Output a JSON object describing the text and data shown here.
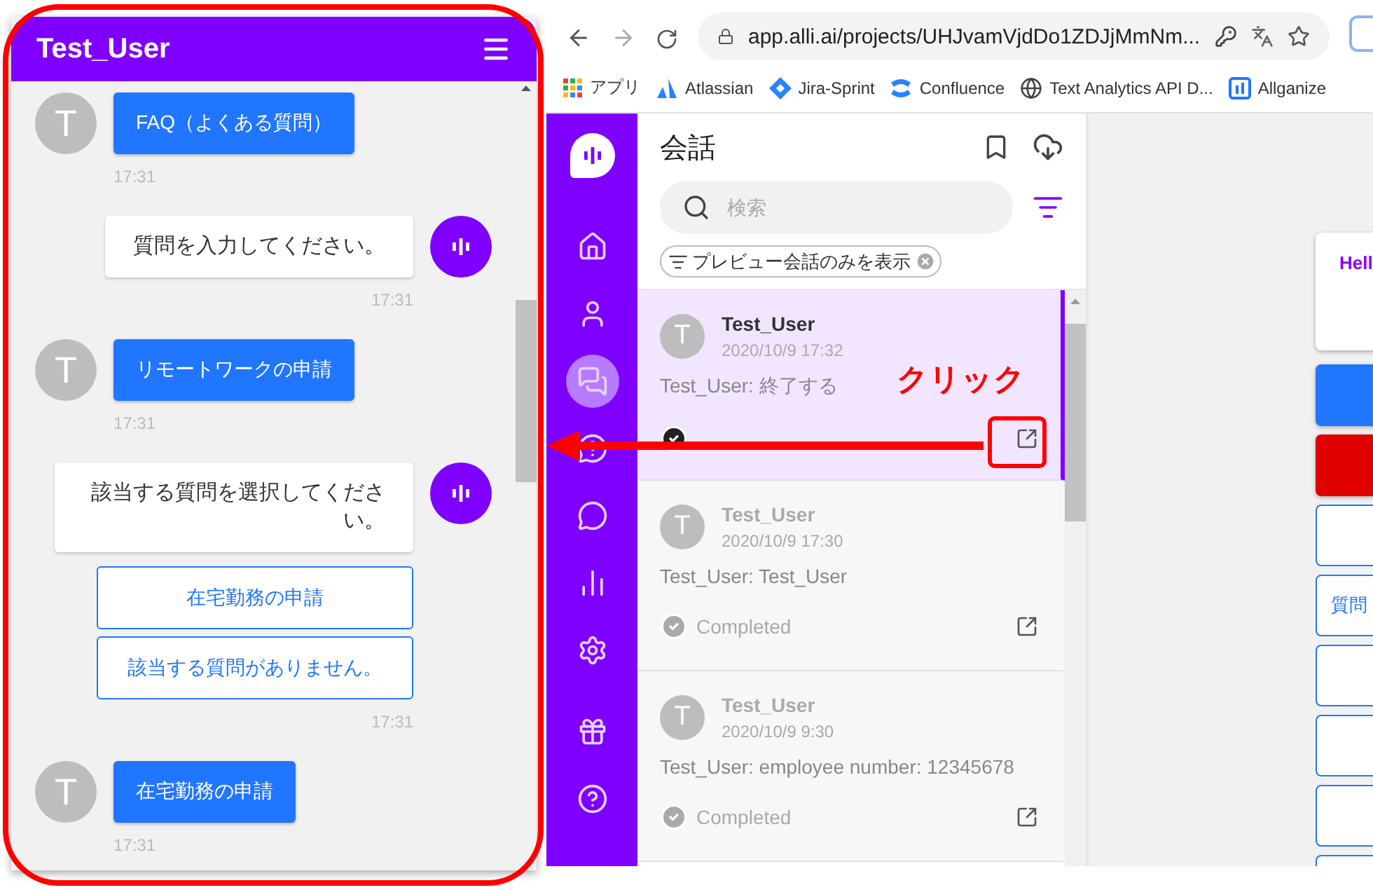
{
  "chat_widget": {
    "title": "Test_User",
    "messages": [
      {
        "kind": "user",
        "avatar": "T",
        "text": "FAQ（よくある質問）",
        "time": "17:31"
      },
      {
        "kind": "bot",
        "text": "質問を入力してください。",
        "time": "17:31"
      },
      {
        "kind": "user",
        "avatar": "T",
        "text": "リモートワークの申請",
        "time": "17:31"
      },
      {
        "kind": "bot",
        "text": "該当する質問を選択してください。",
        "options": [
          "在宅勤務の申請",
          "該当する質問がありません。"
        ],
        "time": "17:31"
      },
      {
        "kind": "user",
        "avatar": "T",
        "text": "在宅勤務の申請",
        "time": "17:31"
      }
    ]
  },
  "browser": {
    "address": "app.alli.ai/projects/UHJvamVjdDo1ZDJjMmNm...",
    "bookmarks": [
      {
        "kind": "apps",
        "label": "アプリ"
      },
      {
        "kind": "atlassian",
        "label": "Atlassian"
      },
      {
        "kind": "jira",
        "label": "Jira-Sprint"
      },
      {
        "kind": "confluence",
        "label": "Confluence"
      },
      {
        "kind": "globe",
        "label": "Text Analytics API D..."
      },
      {
        "kind": "allganize",
        "label": "Allganize"
      }
    ]
  },
  "sidebar": {
    "items": [
      {
        "selected": false
      },
      {
        "selected": false
      },
      {
        "selected": true
      },
      {
        "selected": false
      },
      {
        "selected": false
      },
      {
        "selected": false
      },
      {
        "selected": false
      },
      {
        "selected": false
      },
      {
        "selected": false
      }
    ]
  },
  "conversations": {
    "title": "会話",
    "search": {
      "placeholder": "検索"
    },
    "filter_chip": "プレビュー会話のみを表示",
    "items": [
      {
        "avatar": "T",
        "name": "Test_User",
        "date": "2020/10/9 17:32",
        "preview": "Test_User: 終了する",
        "selected": true
      },
      {
        "avatar": "T",
        "name": "Test_User",
        "date": "2020/10/9 17:30",
        "preview": "Test_User: Test_User",
        "status": "Completed",
        "selected": false
      },
      {
        "avatar": "T",
        "name": "Test_User",
        "date": "2020/10/9 9:30",
        "preview": "Test_User: employee number: 12345678",
        "status": "Completed",
        "selected": false
      }
    ]
  },
  "preview": {
    "cards": [
      {
        "kind": "text",
        "text": "Hell"
      },
      {
        "kind": "filled",
        "color": "#2176ff"
      },
      {
        "kind": "filled",
        "color": "#e00000"
      },
      {
        "kind": "outlined"
      },
      {
        "kind": "outlined",
        "text": "質問"
      },
      {
        "kind": "outlined"
      },
      {
        "kind": "outlined"
      },
      {
        "kind": "outlined"
      },
      {
        "kind": "outlined"
      }
    ]
  },
  "annotation": {
    "label": "クリック"
  }
}
